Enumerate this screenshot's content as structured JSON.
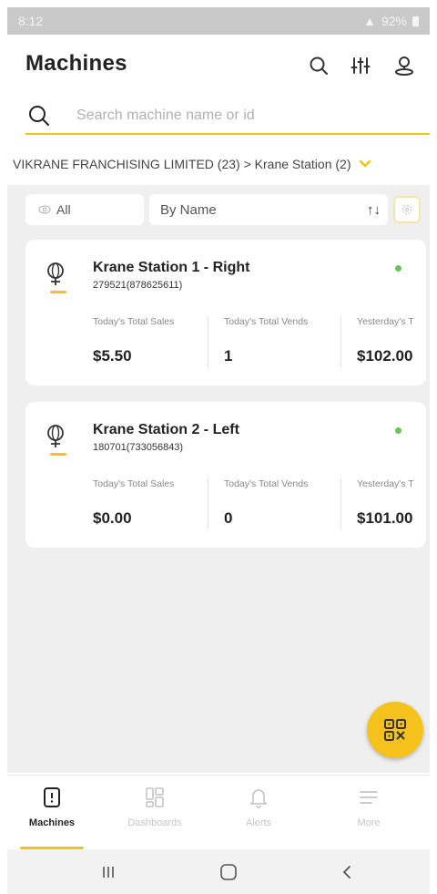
{
  "status_bar": {
    "time": "8:12",
    "battery": "92%"
  },
  "header": {
    "title": "Machines"
  },
  "search": {
    "placeholder": "Search machine name or id",
    "value": ""
  },
  "breadcrumb": {
    "text": "VIKRANE FRANCHISING LIMITED (23) > Krane Station (2)"
  },
  "filters": {
    "all_label": "All",
    "sort_label": "By Name"
  },
  "machines": [
    {
      "name": "Krane Station 1 - Right",
      "id": "279521(878625611)",
      "status": "online",
      "metrics": [
        {
          "label": "Today's Total Sales",
          "value": "$5.50"
        },
        {
          "label": "Today's Total Vends",
          "value": "1"
        },
        {
          "label": "Yesterday's T",
          "value": "$102.00"
        }
      ]
    },
    {
      "name": "Krane Station 2 - Left",
      "id": "180701(733056843)",
      "status": "online",
      "metrics": [
        {
          "label": "Today's Total Sales",
          "value": "$0.00"
        },
        {
          "label": "Today's Total Vends",
          "value": "0"
        },
        {
          "label": "Yesterday's T",
          "value": "$101.00"
        }
      ]
    }
  ],
  "bottom_nav": [
    {
      "label": "Machines",
      "icon": "machine-icon",
      "active": true
    },
    {
      "label": "Dashboards",
      "icon": "dashboard-icon",
      "active": false
    },
    {
      "label": "Alerts",
      "icon": "bell-icon",
      "active": false
    },
    {
      "label": "More",
      "icon": "menu-icon",
      "active": false
    }
  ],
  "colors": {
    "accent": "#f0c419",
    "fab": "#f4c21b",
    "status_online": "#6ac259",
    "background": "#efefef"
  }
}
